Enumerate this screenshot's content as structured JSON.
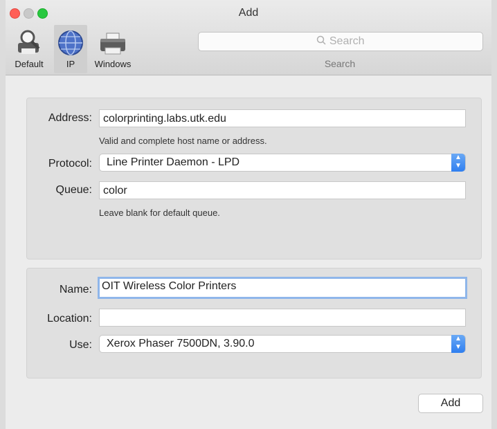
{
  "window": {
    "title": "Add"
  },
  "toolbar": {
    "items": [
      {
        "label": "Default",
        "icon": "default-printer-icon"
      },
      {
        "label": "IP",
        "icon": "globe-icon",
        "selected": true
      },
      {
        "label": "Windows",
        "icon": "windows-printer-icon"
      }
    ],
    "search": {
      "placeholder": "Search",
      "caption": "Search",
      "icon": "search-icon"
    }
  },
  "ip_panel": {
    "address_label": "Address:",
    "address_value": "colorprinting.labs.utk.edu",
    "address_hint": "Valid and complete host name or address.",
    "protocol_label": "Protocol:",
    "protocol_value": "Line Printer Daemon - LPD",
    "queue_label": "Queue:",
    "queue_value": "color",
    "queue_hint": "Leave blank for default queue."
  },
  "info_panel": {
    "name_label": "Name:",
    "name_value": "OIT Wireless Color Printers",
    "location_label": "Location:",
    "location_value": "",
    "use_label": "Use:",
    "use_value": "Xerox Phaser 7500DN, 3.90.0"
  },
  "footer": {
    "add_label": "Add"
  },
  "colors": {
    "accent": "#2f7ff0",
    "focus_ring": "#8fb6ea"
  }
}
